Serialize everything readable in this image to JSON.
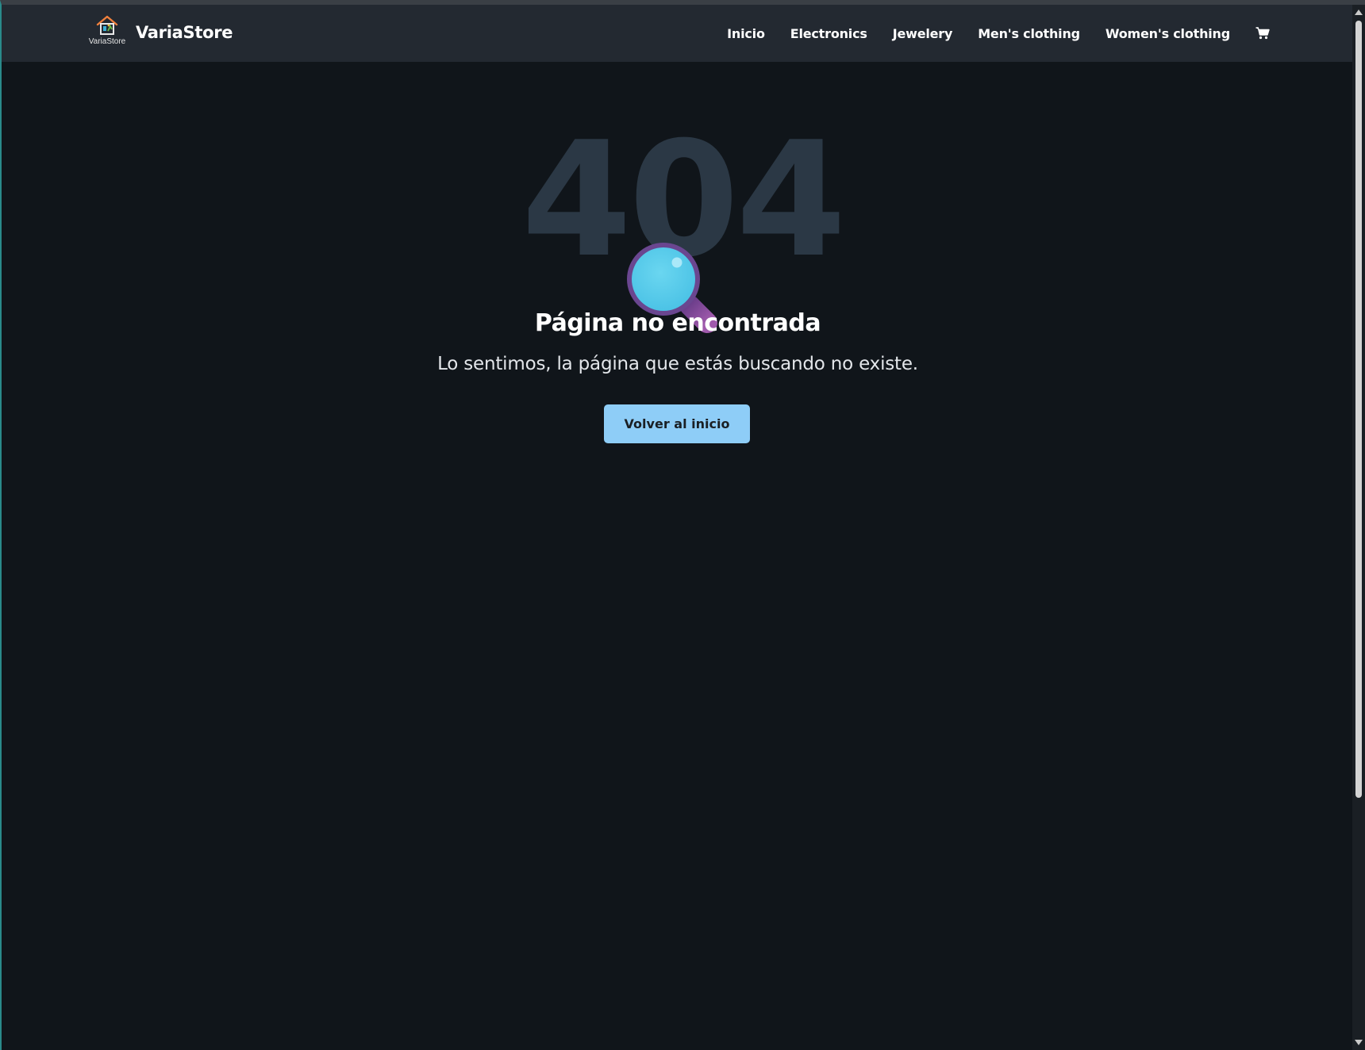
{
  "brand": {
    "logo_text": "VariaStore",
    "name": "VariaStore"
  },
  "nav": {
    "links": [
      "Inicio",
      "Electronics",
      "Jewelery",
      "Men's clothing",
      "Women's clothing"
    ],
    "cart_icon": "shopping-cart-icon"
  },
  "error": {
    "code": "404",
    "title": "Página no encontrada",
    "message": "Lo sentimos, la página que estás buscando no existe.",
    "button_label": "Volver al inicio",
    "illustration_icon": "magnifying-glass-icon"
  },
  "colors": {
    "page_bg": "#10151a",
    "navbar_bg": "#232931",
    "code_color": "#2b3845",
    "button_bg": "#8ecdf7",
    "lens_color": "#5ccfec",
    "handle_color": "#8a4a9e"
  }
}
